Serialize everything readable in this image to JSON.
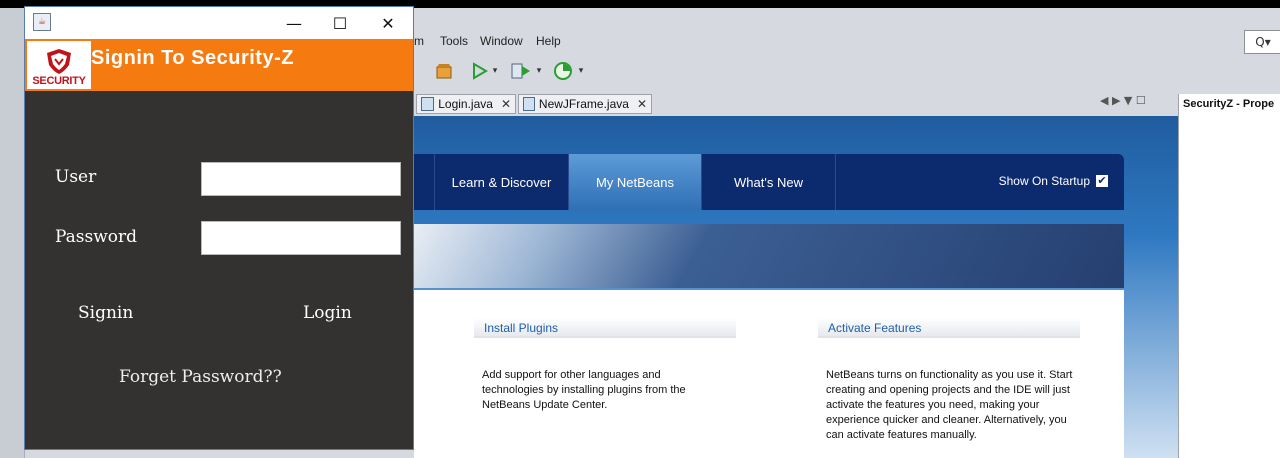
{
  "ide": {
    "menu": [
      "m",
      "Tools",
      "Window",
      "Help"
    ],
    "search_placeholder": "Q▾",
    "tabs": [
      {
        "label": "Login.java",
        "close": "✕"
      },
      {
        "label": "NewJFrame.java",
        "close": "✕"
      }
    ],
    "tab_nav": "◀ ▶ ▼ ☐",
    "properties_title": "SecurityZ - Prope"
  },
  "start_page": {
    "nav_tabs": [
      "Learn & Discover",
      "My NetBeans",
      "What's New"
    ],
    "active_tab": "My NetBeans",
    "show_on_startup": "Show On Startup",
    "show_on_startup_checked": true,
    "install": {
      "heading": "Install Plugins",
      "text": "Add support for other languages and technologies by installing plugins from the NetBeans Update Center."
    },
    "activate": {
      "heading": "Activate Features",
      "text": "NetBeans turns on functionality as you use it. Start creating and opening projects and the IDE will just activate the features you need, making your experience quicker and cleaner. Alternatively, you can activate features manually."
    }
  },
  "dialog": {
    "window_controls": {
      "minimize": "—",
      "maximize": "☐",
      "close": "✕"
    },
    "logo_text": "SECURITY",
    "header_title": "Signin To Security-Z",
    "user_label": "User",
    "user_value": "",
    "password_label": "Password",
    "password_value": "",
    "signin_label": "Signin",
    "login_label": "Login",
    "forget_label": "Forget Password??"
  },
  "colors": {
    "header_orange": "#f57a10",
    "dialog_bg": "#333231",
    "nav_blue": "#0c2a6e",
    "link_blue": "#1f5fa8"
  }
}
